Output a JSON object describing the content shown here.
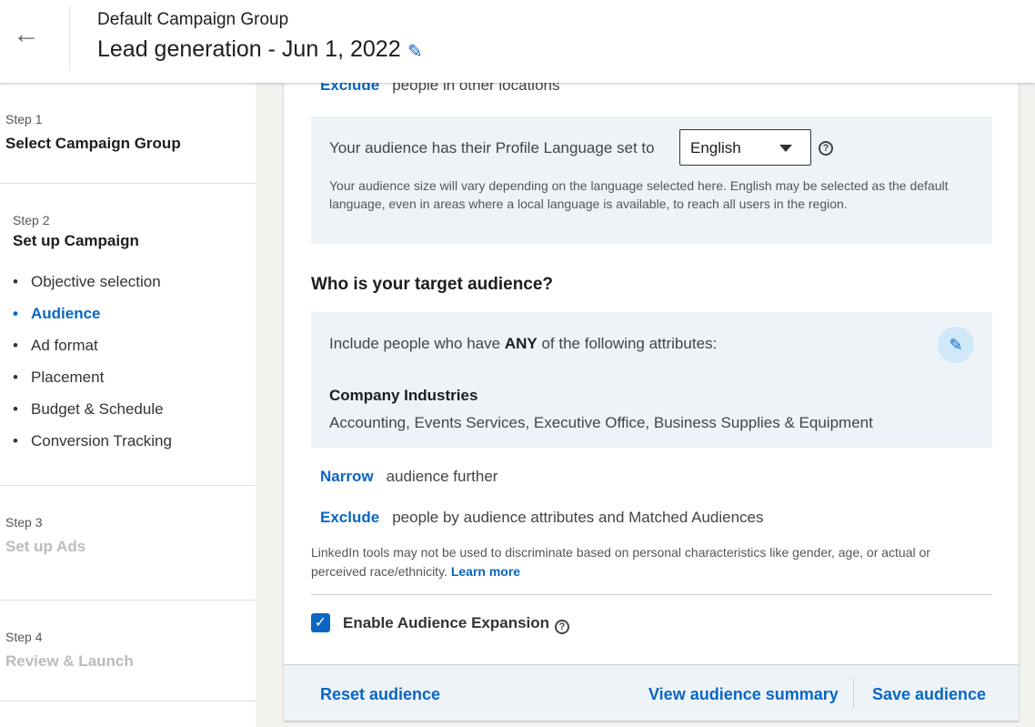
{
  "header": {
    "subtitle": "Default Campaign Group",
    "title": "Lead generation - Jun 1, 2022",
    "back_icon": "arrow-left-icon",
    "edit_icon": "pencil-icon"
  },
  "sidebar": {
    "step1": {
      "number": "Step 1",
      "title": "Select Campaign Group"
    },
    "step2": {
      "number": "Step 2",
      "title": "Set up Campaign",
      "items": [
        "Objective selection",
        "Audience",
        "Ad format",
        "Placement",
        "Budget & Schedule",
        "Conversion Tracking"
      ],
      "active": "Audience"
    },
    "step3": {
      "number": "Step 3",
      "title": "Set up Ads"
    },
    "step4": {
      "number": "Step 4",
      "title": "Review & Launch"
    }
  },
  "main": {
    "exclude_locations": {
      "link": "Exclude",
      "text": "people in other locations"
    },
    "language": {
      "question": "Your audience has their Profile Language set to",
      "selected": "English",
      "note": "Your audience size will vary depending on the language selected here. English may be selected as the default language, even in areas where a local language is available, to reach all users in the region."
    },
    "target_heading": "Who is your target audience?",
    "attributes": {
      "include_prefix": "Include people who have",
      "include_any": "ANY",
      "include_suffix": "of the following attributes:",
      "category": "Company Industries",
      "values": "Accounting, Events Services, Executive Office, Business Supplies & Equipment"
    },
    "narrow": {
      "link": "Narrow",
      "text": "audience further"
    },
    "exclude": {
      "link": "Exclude",
      "text": "people by audience attributes and Matched Audiences"
    },
    "disclaimer": "LinkedIn tools may not be used to discriminate based on personal characteristics like gender, age, or actual or perceived race/ethnicity.",
    "learn_more": "Learn more",
    "expansion": {
      "label": "Enable Audience Expansion",
      "checked": true
    },
    "footer": {
      "reset": "Reset audience",
      "summary": "View audience summary",
      "save": "Save audience"
    }
  },
  "colors": {
    "accent": "#0a66c2",
    "panel": "#eef3f8"
  }
}
